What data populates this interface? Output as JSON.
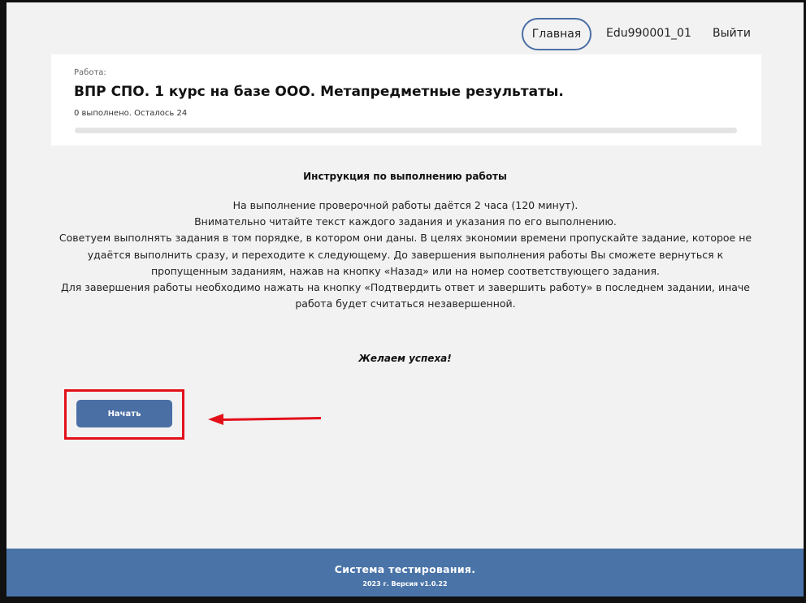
{
  "nav": {
    "home": "Главная",
    "user": "Edu990001_01",
    "logout": "Выйти"
  },
  "work": {
    "label": "Работа:",
    "title": "ВПР СПО. 1 курс на базе ООО. Метапредметные результаты.",
    "progress_text": "0 выполнено. Осталось 24",
    "completed": 0,
    "remaining": 24,
    "progress_fraction": 0
  },
  "instructions": {
    "title": "Инструкция по выполнению работы",
    "paragraphs": [
      "На выполнение проверочной работы даётся 2 часа (120 минут).",
      "Внимательно читайте текст каждого задания и указания по его выполнению.",
      "Советуем выполнять задания в том порядке, в котором они даны. В целях экономии времени пропускайте задание, которое не удаётся выполнить сразу, и переходите к следующему. До завершения выполнения работы Вы сможете вернуться к пропущенным заданиям, нажав на кнопку «Назад» или на номер соответствующего задания.",
      "Для завершения работы необходимо нажать на кнопку «Подтвердить ответ и завершить работу» в последнем задании, иначе работа будет считаться незавершенной."
    ],
    "wish": "Желаем успеха!"
  },
  "start_button": {
    "label": "Начать"
  },
  "annotation": {
    "highlight_color": "#e3101a",
    "arrow_icon": "left-arrow-icon"
  },
  "footer": {
    "title": "Система тестирования.",
    "version": "2023 г. Версия v1.0.22"
  },
  "colors": {
    "accent": "#4a6fa5",
    "footer_bg": "#4a74a8",
    "page_bg": "#f2f2f2"
  }
}
